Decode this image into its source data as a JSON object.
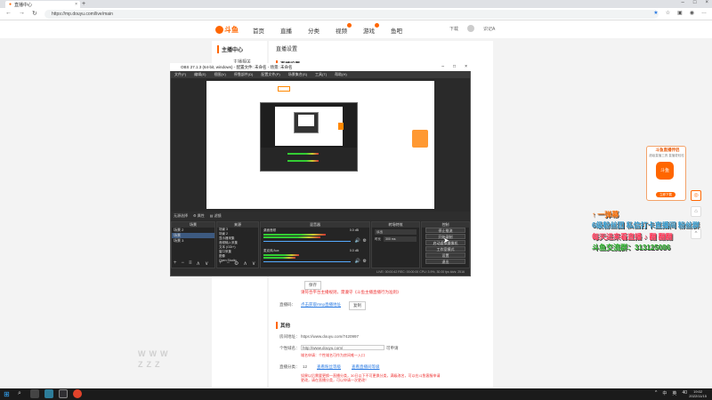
{
  "browser": {
    "tab_title": "直播中心",
    "url": "https://mp.douyu.com/live/main"
  },
  "douyu": {
    "nav": [
      "首页",
      "直播",
      "分类",
      "视频",
      "游戏",
      "鱼吧"
    ],
    "logo_text": "斗鱼",
    "user_links": [
      "下载",
      "识记A"
    ],
    "side_title": "主播中心",
    "side_item": "主播相关",
    "main_title": "直播设置",
    "main_sub": "直播设置",
    "button_label": "保存",
    "notice_red": "请符合平台主播规则，需遵守《斗鱼主播直播行为准则》",
    "link_row_label": "直播码：",
    "link_text": "点击获取rtmp直播地址",
    "link_button": "复制",
    "section_other": "其他",
    "room_url_label": "房间地址：",
    "room_url": "https://www.douyu.com/7420997",
    "domain_label": "个性域名：",
    "domain_prefix": "http://www.douyu.com/",
    "domain_hint": "域名申请：个性域名可作为房间唯一入口",
    "domain_select": "可申请",
    "level_label": "直播分类：",
    "level_value": "12",
    "level_link1": "查看粉丝等级",
    "level_link2": "查看直播间等级",
    "bottom_note": "如果以后需要更换一直播分类，30日以下不可更换分类，满级改名，可以在斗鱼客服申请更改，请在直播分类，可以申请一次更改！"
  },
  "obs": {
    "title": "OBS 27.1.3 (64-bit, windows) - 配置文件: 未命名 - 场景: 未命名",
    "menu": [
      "文件(F)",
      "编辑(E)",
      "视图(V)",
      "停靠部件(D)",
      "配置文件(P)",
      "场景集合(S)",
      "工具(T)",
      "帮助(H)"
    ],
    "toolbar": [
      "无源选择",
      "属性",
      "滤镜"
    ],
    "scenes_header": "场景",
    "scenes": [
      "场景 2",
      "场景",
      "场景 3"
    ],
    "sources_header": "来源",
    "sources": [
      "场景 3",
      "场景 2",
      "显示器采集",
      "音频输入采集",
      "文本 (GDI+)",
      "窗口采集",
      "图像",
      "Open Studio"
    ],
    "mixer_header": "混音器",
    "mixer_tracks": [
      "桌面音频",
      "麦克风/Aux"
    ],
    "mixer_db": [
      "0.0 dB",
      "0.0 dB"
    ],
    "transitions_header": "转场特效",
    "transition_type": "淡出",
    "transition_duration_label": "时长",
    "transition_duration": "300 ms",
    "controls_header": "控制",
    "controls": [
      "停止推流",
      "开始录制",
      "启动虚拟摄像机",
      "工作室模式",
      "设置",
      "退出"
    ],
    "status": "LIVE: 00:00:42  REC: 00:00:00  CPU: 3.9%, 30.00 fps  kb/s: 2516"
  },
  "ad": {
    "title": "斗鱼直播伴侣",
    "subtitle": "超级直播工具 直播更轻松",
    "icon_label": "斗鱼",
    "button": "立即下载"
  },
  "overlay": [
    "↑ 一弹幕",
    "6级粉丝团 私信打卡直播间 粉丝群",
    "每天进来看直播 ♪ 翻 翻翻",
    "斗鱼交流群：313125086"
  ],
  "watermark": "WWW ZZZ",
  "taskbar": {
    "clock_time": "19:02",
    "clock_date": "2022/11/15",
    "tray": [
      "^",
      "中",
      "英",
      "40"
    ]
  },
  "colors": {
    "douyu_orange": "#f60",
    "obs_bg": "#2b2b2b",
    "link_blue": "#2a7ae2",
    "warning_red": "#e33"
  }
}
